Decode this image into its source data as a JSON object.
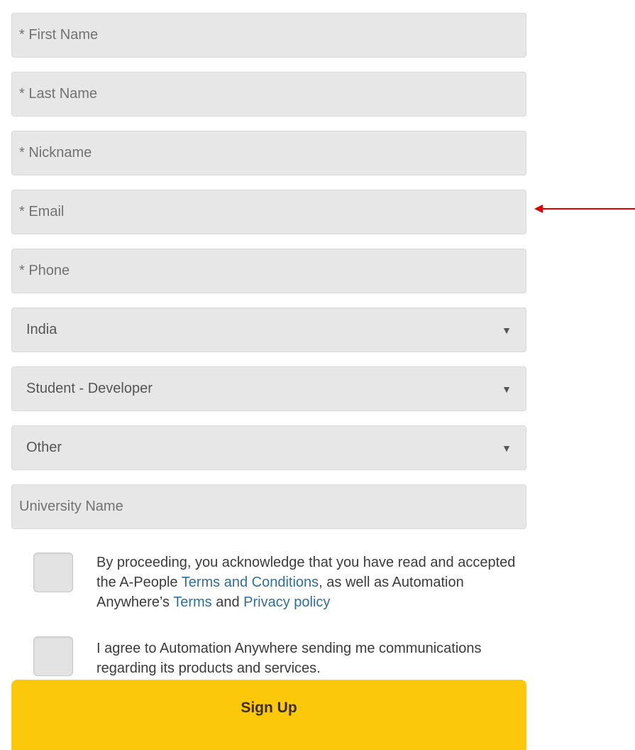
{
  "fields": {
    "first_name": "* First Name",
    "last_name": "* Last Name",
    "nickname": "* Nickname",
    "email": "* Email",
    "phone": "* Phone",
    "university": "University Name"
  },
  "selects": {
    "country": "India",
    "role": "Student - Developer",
    "other": "Other",
    "caret": "▼"
  },
  "consent": {
    "terms_before": "By proceeding, you acknowledge that you have read and accepted the A-People ",
    "terms_link": "Terms and Conditions",
    "terms_mid": ", as well as Automation Anywhere’s ",
    "terms_link2": "Terms",
    "terms_and": " and ",
    "privacy_link": "Privacy policy",
    "marketing": "I agree to Automation Anywhere sending me communications regarding its products and services."
  },
  "signup_label": "Sign Up",
  "colors": {
    "accent": "#fbc80a",
    "link": "#2f6fa0",
    "annotation": "#e00000"
  },
  "annotation": {
    "arrow_icon": "left-arrow-icon"
  }
}
